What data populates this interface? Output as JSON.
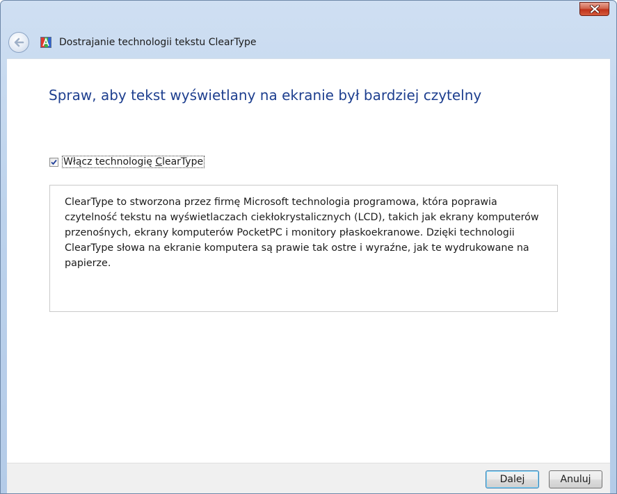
{
  "window": {
    "title": "Dostrajanie technologii tekstu ClearType"
  },
  "page": {
    "heading": "Spraw, aby tekst wyświetlany na ekranie był bardziej czytelny",
    "checkbox": {
      "label_before": "Włącz technologię ",
      "label_accel": "C",
      "label_after": "learType",
      "checked": true
    },
    "description": "ClearType to stworzona przez firmę Microsoft technologia programowa, która poprawia czytelność tekstu na wyświetlaczach ciekłokrystalicznych (LCD), takich jak ekrany komputerów przenośnych, ekrany komputerów PocketPC i monitory płaskoekranowe. Dzięki technologii ClearType słowa na ekranie komputera są prawie tak ostre i wyraźne, jak te wydrukowane na papierze."
  },
  "buttons": {
    "next_label": "Dalej",
    "cancel_label": "Anuluj"
  },
  "icons": {
    "close": "close-icon",
    "back": "back-arrow-icon",
    "app": "cleartype-app-icon",
    "check": "checkmark-icon"
  },
  "colors": {
    "heading": "#1e3f8f",
    "close_button": "#c0321a",
    "frame": "#bcd2ec"
  }
}
